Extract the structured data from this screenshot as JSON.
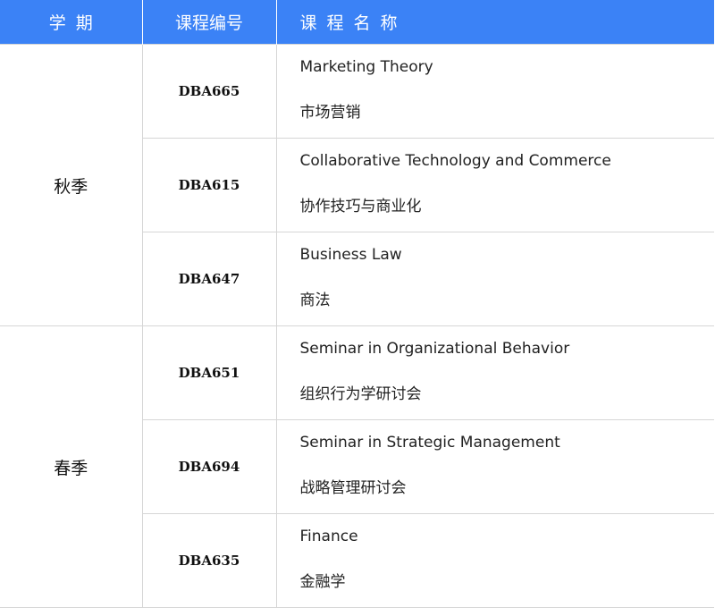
{
  "header": {
    "term": [
      "学",
      "期"
    ],
    "code": "课程编号",
    "name": [
      "课",
      "程",
      "名",
      "称"
    ]
  },
  "colors": {
    "header_bg": "#3b82f6",
    "header_text": "#ffffff",
    "grid": "#d6d6d6"
  },
  "terms": [
    {
      "label": "秋季",
      "courses": [
        {
          "code": "DBA665",
          "name_en": "Marketing Theory",
          "name_zh": "市场营销"
        },
        {
          "code": "DBA615",
          "name_en": "Collaborative Technology and Commerce",
          "name_zh": "协作技巧与商业化"
        },
        {
          "code": "DBA647",
          "name_en": "Business Law",
          "name_zh": "商法"
        }
      ]
    },
    {
      "label": "春季",
      "courses": [
        {
          "code": "DBA651",
          "name_en": "Seminar in Organizational Behavior",
          "name_zh": "组织行为学研讨会"
        },
        {
          "code": "DBA694",
          "name_en": "Seminar in Strategic Management",
          "name_zh": "战略管理研讨会"
        },
        {
          "code": "DBA635",
          "name_en": "Finance",
          "name_zh": "金融学"
        }
      ]
    }
  ]
}
